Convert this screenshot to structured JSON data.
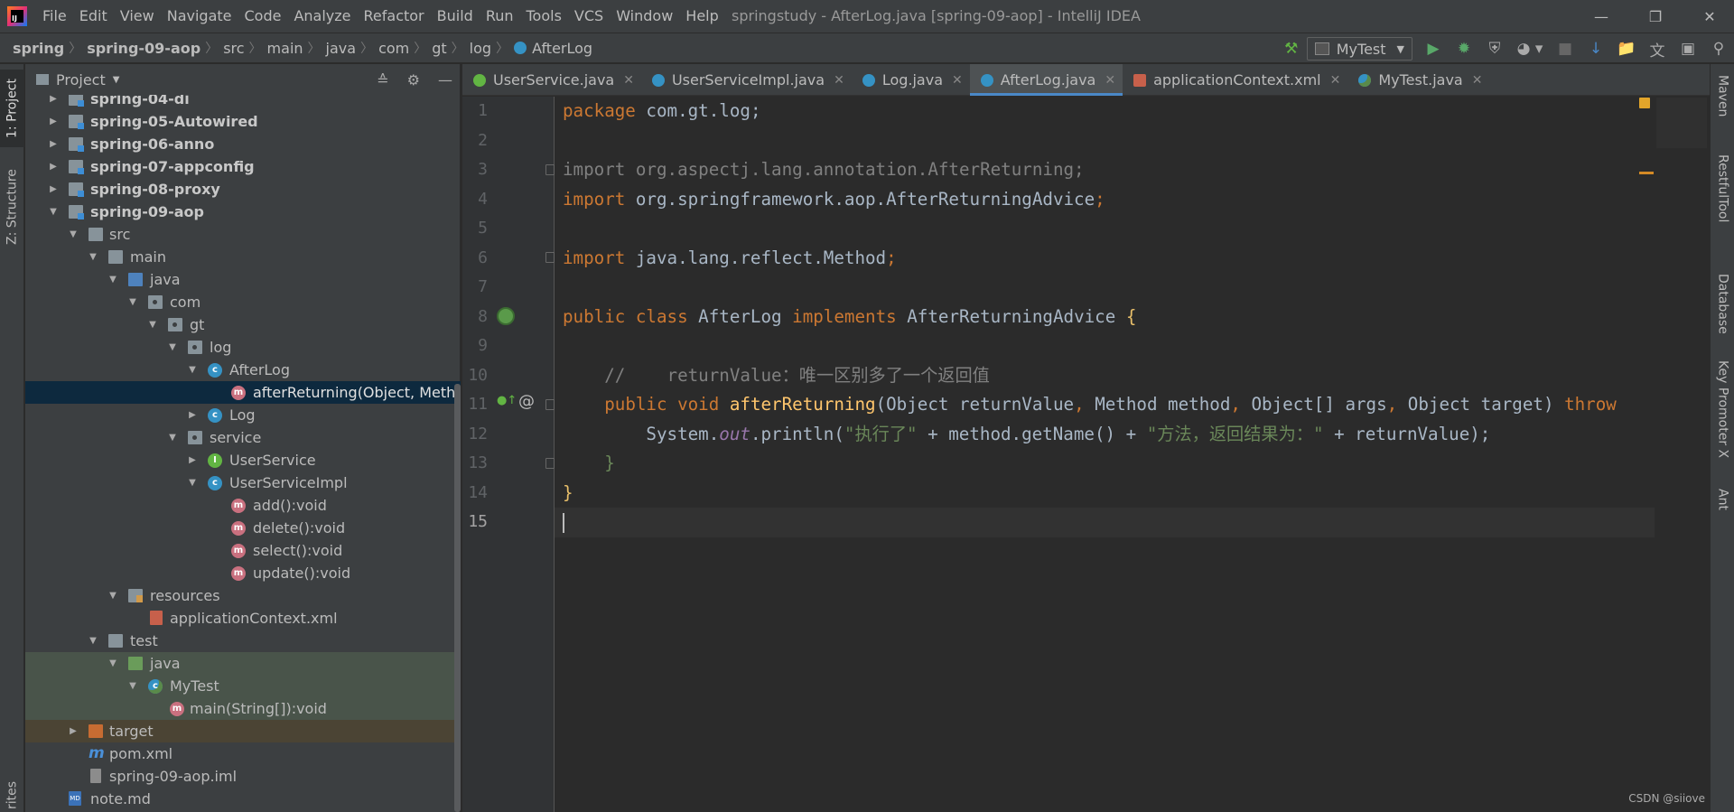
{
  "app": {
    "window_title": "springstudy - AfterLog.java [spring-09-aop] - IntelliJ IDEA",
    "menu": [
      "File",
      "Edit",
      "View",
      "Navigate",
      "Code",
      "Analyze",
      "Refactor",
      "Build",
      "Run",
      "Tools",
      "VCS",
      "Window",
      "Help"
    ]
  },
  "breadcrumb": [
    "spring",
    "spring-09-aop",
    "src",
    "main",
    "java",
    "com",
    "gt",
    "log",
    "AfterLog"
  ],
  "toolbar": {
    "run_config": "MyTest"
  },
  "left_strip": {
    "project_tab": "1: Project",
    "structure_tab": "Z: Structure",
    "favorites_tab": "rites"
  },
  "project_panel": {
    "title": "Project",
    "tree": [
      {
        "label": "spring-04-di"
      },
      {
        "label": "spring-05-Autowired"
      },
      {
        "label": "spring-06-anno"
      },
      {
        "label": "spring-07-appconfig"
      },
      {
        "label": "spring-08-proxy"
      },
      {
        "label": "spring-09-aop"
      },
      {
        "label": "src"
      },
      {
        "label": "main"
      },
      {
        "label": "java"
      },
      {
        "label": "com"
      },
      {
        "label": "gt"
      },
      {
        "label": "log"
      },
      {
        "label": "AfterLog"
      },
      {
        "label": "afterReturning(Object, Method,"
      },
      {
        "label": "Log"
      },
      {
        "label": "service"
      },
      {
        "label": "UserService"
      },
      {
        "label": "UserServiceImpl"
      },
      {
        "label": "add():void"
      },
      {
        "label": "delete():void"
      },
      {
        "label": "select():void"
      },
      {
        "label": "update():void"
      },
      {
        "label": "resources"
      },
      {
        "label": "applicationContext.xml"
      },
      {
        "label": "test"
      },
      {
        "label": "java"
      },
      {
        "label": "MyTest"
      },
      {
        "label": "main(String[]):void"
      },
      {
        "label": "target"
      },
      {
        "label": "pom.xml"
      },
      {
        "label": "spring-09-aop.iml"
      },
      {
        "label": "note.md"
      }
    ]
  },
  "editor_tabs": [
    {
      "label": "UserService.java"
    },
    {
      "label": "UserServiceImpl.java"
    },
    {
      "label": "Log.java"
    },
    {
      "label": "AfterLog.java",
      "active": true
    },
    {
      "label": "applicationContext.xml"
    },
    {
      "label": "MyTest.java"
    }
  ],
  "editor": {
    "line_numbers": [
      "1",
      "2",
      "3",
      "4",
      "5",
      "6",
      "7",
      "8",
      "9",
      "10",
      "11",
      "12",
      "13",
      "14",
      "15"
    ],
    "code": {
      "l1_kw": "package",
      "l1_rest": " com.gt.log;",
      "l3_kw": "import",
      "l3_rest": " org.aspectj.lang.annotation.AfterReturning;",
      "l4_kw": "import",
      "l4_rest": " org.springframework.aop.AfterReturningAdvice",
      "l6_kw": "import",
      "l6_rest": " java.lang.reflect.Method",
      "l8_kw1": "public class",
      "l8_name": " AfterLog ",
      "l8_kw2": "implements",
      "l8_iface": " AfterReturningAdvice ",
      "l10_comment": "    //    returnValue：唯一区别多了一个返回值",
      "l11_indent": "    ",
      "l11_kw": "public void",
      "l11_fn": " afterReturning",
      "l11_p1": "(Object returnValue",
      "l11_p2": " Method method",
      "l11_p3": " Object[] args",
      "l11_p4": " Object target) ",
      "l11_kw2": "throw",
      "l12_a": "        System.",
      "l12_out": "out",
      "l12_b": ".println(",
      "l12_s1": "\"执行了\"",
      "l12_c": " + method.getName() + ",
      "l12_s2": "\"方法，返回结果为：\"",
      "l12_d": " + returnValue);",
      "l13": "    }",
      "l14": "}"
    }
  },
  "right_strip": [
    "Maven",
    "RestfulTool",
    "Database",
    "Key Promoter X",
    "Ant"
  ],
  "watermark": "CSDN @siiove"
}
